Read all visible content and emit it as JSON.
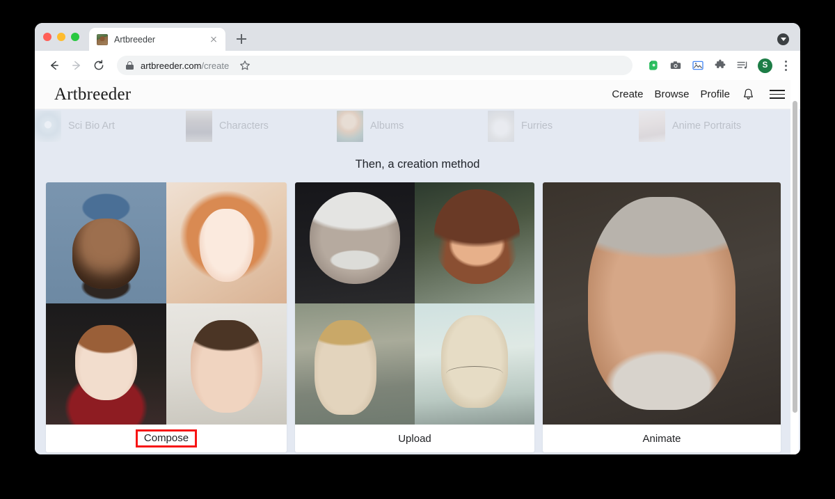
{
  "browser": {
    "traffic_lights": [
      "close",
      "minimize",
      "maximize"
    ],
    "tab": {
      "title": "Artbreeder",
      "favicon_name": "artbreeder-favicon",
      "close_label": "×"
    },
    "new_tab_label": "+",
    "toolbar": {
      "back_label": "Back",
      "forward_label": "Forward",
      "reload_label": "Reload",
      "url_domain": "artbreeder.com",
      "url_path": "/create",
      "url_full": "artbreeder.com/create",
      "lock_icon": "lock-icon",
      "star_icon": "bookmark-star-icon",
      "extensions": [
        {
          "name": "evernote-icon",
          "color": "#2dbe60"
        },
        {
          "name": "camera-icon",
          "color": "#5f6368"
        },
        {
          "name": "image-capture-icon",
          "color": "#5f6368"
        },
        {
          "name": "puzzle-extensions-icon",
          "color": "#5f6368"
        },
        {
          "name": "playlist-music-icon",
          "color": "#5f6368"
        }
      ],
      "avatar_initial": "S",
      "avatar_color": "#1d7d46",
      "menu_icon": "kebab-menu-icon"
    },
    "tab_strip_menu_icon": "tab-download-chevron-icon"
  },
  "site": {
    "logo": "Artbreeder",
    "nav": [
      {
        "label": "Create"
      },
      {
        "label": "Browse"
      },
      {
        "label": "Profile"
      }
    ],
    "bell_icon": "notification-bell-icon",
    "hamburger_icon": "hamburger-menu-icon"
  },
  "categories": [
    {
      "label": "Sci Bio Art",
      "thumb": "t1"
    },
    {
      "label": "Characters",
      "thumb": "t2"
    },
    {
      "label": "Albums",
      "thumb": "t3"
    },
    {
      "label": "Furries",
      "thumb": "t4"
    },
    {
      "label": "Anime Portraits",
      "thumb": "t5"
    }
  ],
  "main": {
    "section_heading": "Then, a creation method",
    "methods": [
      {
        "label": "Compose",
        "highlighted": true,
        "highlight_color": "#f71414",
        "layout": "grid-2x2",
        "thumbnails": [
          "portrait-man-with-bandana",
          "portrait-redhead-young-woman",
          "portrait-short-hair-woman-red-shirt",
          "portrait-young-boy"
        ]
      },
      {
        "label": "Upload",
        "highlighted": false,
        "layout": "grid-2x2",
        "thumbnails": [
          "portrait-albert-einstein",
          "portrait-bob-ross",
          "portrait-american-gothic-woman",
          "portrait-american-gothic-man"
        ]
      },
      {
        "label": "Animate",
        "highlighted": false,
        "layout": "single",
        "thumbnails": [
          "portrait-elderly-man-gray-beard"
        ]
      }
    ]
  },
  "scrollbar": {
    "orientation": "vertical",
    "visible": true
  }
}
